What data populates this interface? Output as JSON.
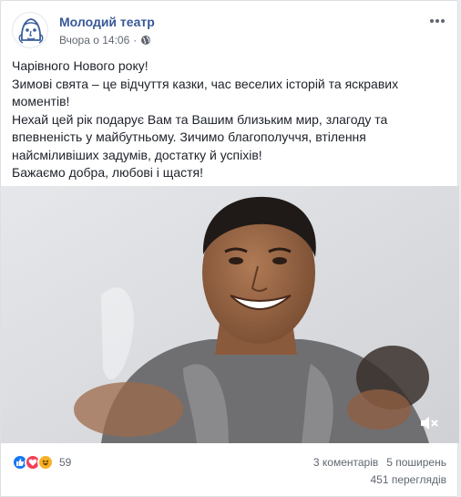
{
  "post": {
    "page_name": "Молодий театр",
    "time": "Вчора о 14:06",
    "separator": "·",
    "text_lines": [
      "Чарівного Нового року!",
      "Зимові свята – це відчуття казки, час веселих історій та яскравих моментів!",
      "Нехай цей рік подарує Вам та Вашим близьким мир, злагоду та впевненість у майбутньому. Зичимо благополуччя, втілення найсміливіших задумів, достатку й успіхів!",
      "Бажаємо добра, любові і щастя!"
    ]
  },
  "icons": {
    "more": "more-icon",
    "globe": "globe-icon",
    "mute": "speaker-muted-icon",
    "reactions": [
      "like-icon",
      "love-icon",
      "haha-icon"
    ]
  },
  "footer": {
    "reaction_count": "59",
    "comments": "3 коментарів",
    "shares": "5 поширень",
    "views": "451 переглядів"
  },
  "colors": {
    "brand_link": "#385898",
    "like": "#1877f2",
    "love": "#f33e58",
    "haha": "#f7b125"
  }
}
